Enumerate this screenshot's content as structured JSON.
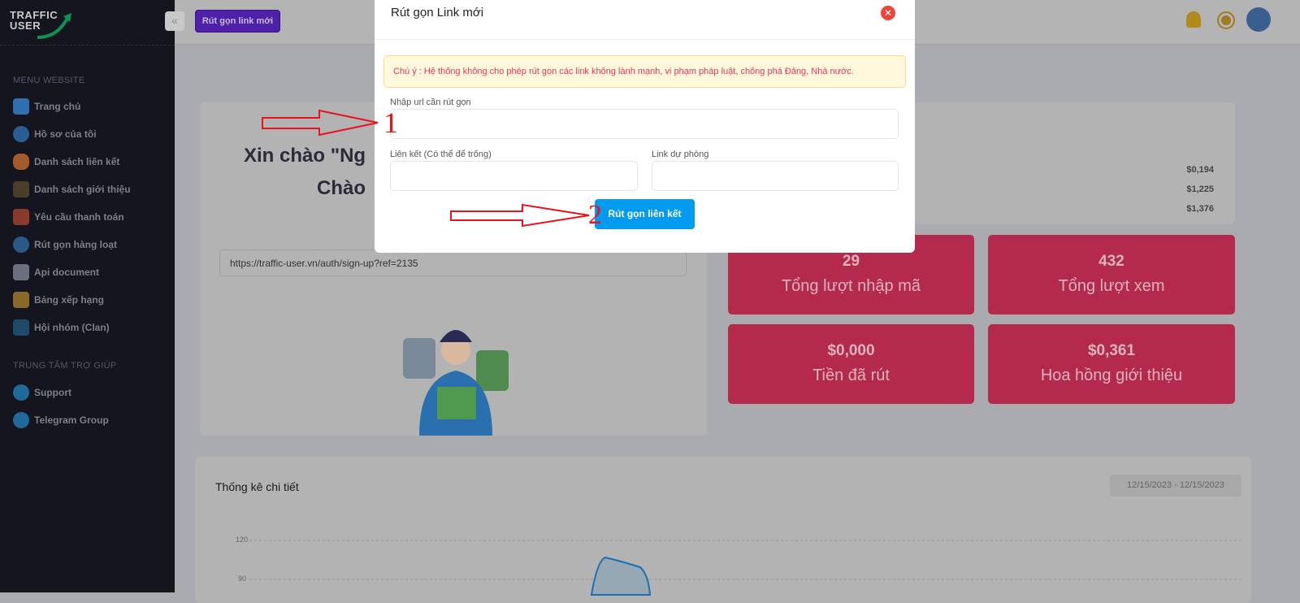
{
  "logo": {
    "line1": "TRAFFIC",
    "line2": "USER"
  },
  "topbar": {
    "new_link_button": "Rút gọn link mới",
    "collapse_icon": "chevrons-left-icon",
    "icons": [
      "bell-icon",
      "theme-toggle-icon",
      "user-avatar-icon"
    ]
  },
  "sidebar": {
    "section1": "MENU WEBSITE",
    "items": [
      {
        "label": "Trang chủ",
        "icon": "home-icon"
      },
      {
        "label": "Hồ sơ của tôi",
        "icon": "user-profile-icon"
      },
      {
        "label": "Danh sách liên kết",
        "icon": "link-icon"
      },
      {
        "label": "Danh sách giới thiệu",
        "icon": "referral-icon"
      },
      {
        "label": "Yêu cầu thanh toán",
        "icon": "payment-icon"
      },
      {
        "label": "Rút gọn hàng loạt",
        "icon": "bulk-shorten-icon"
      },
      {
        "label": "Api document",
        "icon": "document-icon"
      },
      {
        "label": "Bảng xếp hạng",
        "icon": "trophy-icon"
      },
      {
        "label": "Hội nhóm (Clan)",
        "icon": "banner-icon"
      }
    ],
    "section2": "TRUNG TÂM TRỢ GIÚP",
    "help": [
      {
        "label": "Support",
        "icon": "telegram-icon"
      },
      {
        "label": "Telegram Group",
        "icon": "telegram-icon"
      }
    ]
  },
  "welcome": {
    "line1": "Xin chào \"Ng",
    "line2": "Chào",
    "ref_link": "https://traffic-user.vn/auth/sign-up?ref=2135"
  },
  "earnings": [
    "$0,194",
    "$1,225",
    "$1,376"
  ],
  "stats": [
    {
      "value": "29",
      "label": "Tổng lượt nhập mã"
    },
    {
      "value": "432",
      "label": "Tổng lượt xem"
    },
    {
      "value": "$0,000",
      "label": "Tiền đã rút"
    },
    {
      "value": "$0,361",
      "label": "Hoa hồng giới thiệu"
    }
  ],
  "detail": {
    "title": "Thống kê chi tiết",
    "date_range": "12/15/2023 - 12/15/2023",
    "y_ticks": [
      "120",
      "90"
    ]
  },
  "modal": {
    "title": "Rút gọn Link mới",
    "notice": "Chú ý : Hệ thống không cho phép rút gọn các link không lành mạnh, vi phạm pháp luật, chống phá Đảng, Nhà nước.",
    "url_label": "Nhập url cần rút gọn",
    "url_value": "",
    "alias_label": "Liên kết (Có thể để trống)",
    "alias_value": "",
    "backup_label": "Link dự phòng",
    "backup_value": "",
    "submit": "Rút gọn liên kết"
  },
  "annotations": {
    "step1": "1",
    "step2": "2",
    "color": "#e8141b"
  }
}
